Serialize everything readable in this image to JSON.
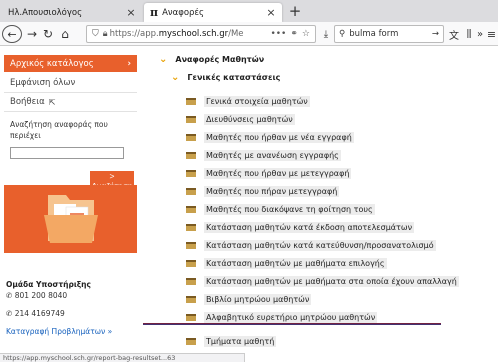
{
  "browser": {
    "tabs": [
      {
        "label": "Ηλ.Απουσιολόγος"
      },
      {
        "label": "Αναφορές",
        "glyph": "π"
      }
    ],
    "new_tab": "+",
    "url_prefix": "https://app.",
    "url_domain": "myschool.sch.gr",
    "url_suffix": "/Me",
    "search_value": "bulma form",
    "status_url": "https://app.myschool.sch.gr/report-bag-resultset...63"
  },
  "sidebar": {
    "active_item": "Αρχικός κατάλογος",
    "items": [
      "Εμφάνιση όλων",
      "Βοήθεια"
    ],
    "search_label": "Αναζήτηση αναφοράς που περιέχει",
    "search_value": "",
    "search_button": "> Αναζήτηση",
    "support_title": "Ομάδα Υποστήριξης",
    "support_phone1": "801 200 8040",
    "support_phone2": "214 4169749",
    "support_link": "Καταγραφή Προβλημάτων »"
  },
  "content": {
    "section_title": "Αναφορές Μαθητών",
    "subsection_title": "Γενικές καταστάσεις",
    "items": [
      "Γενικά στοιχεία μαθητών",
      "Διευθύνσεις μαθητών",
      "Μαθητές που ήρθαν με νέα εγγραφή",
      "Μαθητές με ανανέωση εγγραφής",
      "Μαθητές που ήρθαν με μετεγγραφή",
      "Μαθητές που πήραν μετεγγραφή",
      "Μαθητές που διακόψανε τη φοίτηση τους",
      "Κατάσταση μαθητών κατά έκδοση αποτελεσμάτων",
      "Κατάσταση μαθητών κατά κατεύθυνση/προσανατολισμό",
      "Κατάσταση μαθητών με μαθήματα επιλογής",
      "Κατάσταση μαθητών με μαθήματα στα οποία έχουν απαλλαγή",
      "Βιβλίο μητρώου μαθητών",
      "Αλφαβητικό ευρετήριο μητρώου μαθητών",
      "Τμήματα μαθητή"
    ]
  }
}
